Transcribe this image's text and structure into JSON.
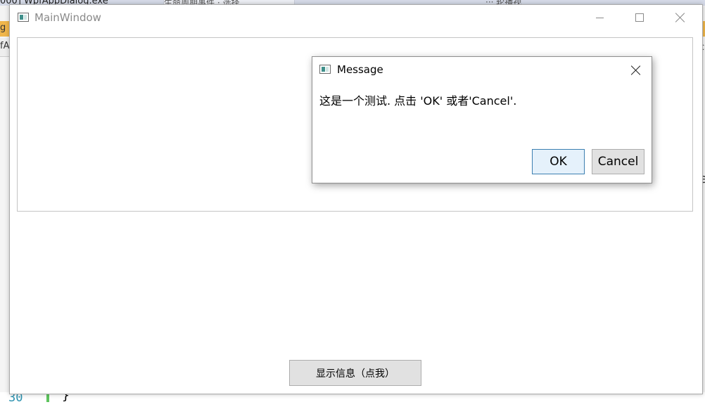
{
  "background": {
    "title_fragment": "000] WpfAppDialog.exe",
    "tab_fragment": "生命周期事件 · 选择",
    "right_fragment": "··· 轮播视",
    "left_text_1": "g",
    "left_text_2": "fA",
    "right_text_1": "c",
    "right_text_2": "e",
    "line_number": "30",
    "code_text": "}"
  },
  "main_window": {
    "title": "MainWindow",
    "show_info_button": "显示信息（点我）"
  },
  "message_dialog": {
    "title": "Message",
    "text": "这是一个测试. 点击 'OK' 或者'Cancel'.",
    "ok_label": "OK",
    "cancel_label": "Cancel"
  },
  "icons": [
    "window-icon",
    "minimize-icon",
    "maximize-icon",
    "close-icon"
  ],
  "colors": {
    "ok_button_border": "#3c7fb1",
    "ok_button_bg": "#e5f1fb",
    "button_bg": "#e1e1e1"
  }
}
